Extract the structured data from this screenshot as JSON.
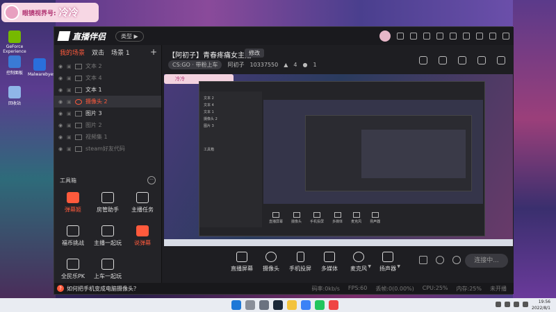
{
  "overlay": {
    "label": "眼镜视界号:",
    "name": "冷冷"
  },
  "app": {
    "title": "直播伴侣",
    "type_button": "类型 ▶"
  },
  "scene": {
    "tabs": [
      "我的场景",
      "双击",
      "场景 1"
    ],
    "add": "+"
  },
  "sources": [
    {
      "label": "文本 2"
    },
    {
      "label": "文本 4"
    },
    {
      "label": "文本 1"
    },
    {
      "label": "摄像头 2"
    },
    {
      "label": "图片 3"
    },
    {
      "label": "图片 2"
    },
    {
      "label": "视频集 1"
    },
    {
      "label": "steam好友代码"
    }
  ],
  "toolbox": {
    "title": "工具箱",
    "items": [
      {
        "label": "弹幕姬"
      },
      {
        "label": "房管助手"
      },
      {
        "label": "主播任务"
      },
      {
        "label": "福币挑战"
      },
      {
        "label": "主播一起玩"
      },
      {
        "label": "说弹幕"
      },
      {
        "label": "全民乐PK"
      },
      {
        "label": "上车一起玩"
      }
    ]
  },
  "help_text": "如何把手机变成电脑摄像头？",
  "stats": [
    "码率:0kb/s",
    "FPS:60",
    "丢帧:0(0.00%)",
    "CPU:25%",
    "内存:25%",
    "未开播"
  ],
  "room": {
    "title": "【阿初子】青春疼痛女主播",
    "edit": "修改",
    "game": "CS:GO · 带粉上车",
    "streamer": "阿初子",
    "room_id": "10337550",
    "likes": "4",
    "viewers": "1"
  },
  "controls": [
    {
      "label": "直播屏幕"
    },
    {
      "label": "摄像头"
    },
    {
      "label": "手机投屏"
    },
    {
      "label": "多媒体"
    },
    {
      "label": "麦克风"
    },
    {
      "label": "扬声器"
    }
  ],
  "live_button": "连接中...",
  "desktop_icons": [
    {
      "label": "GeForce Experience"
    },
    {
      "label": "控制面板"
    },
    {
      "label": "Malwarebyes"
    },
    {
      "label": "回收站"
    }
  ],
  "clock": {
    "time": "19:56",
    "date": "2022/8/1"
  },
  "colors": {
    "accent": "#ff5a3c",
    "panel": "#232327",
    "bg": "#1e1e22"
  }
}
